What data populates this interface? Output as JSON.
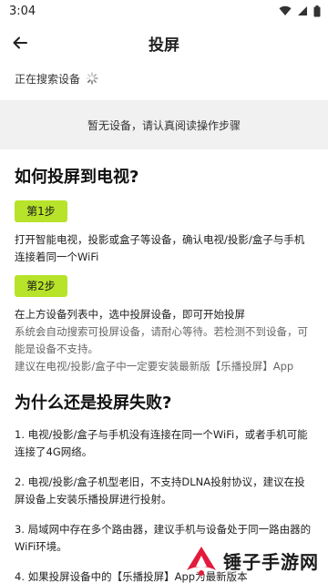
{
  "status_bar": {
    "time": "3:04"
  },
  "app_bar": {
    "title": "投屏"
  },
  "search": {
    "status_text": "正在搜索设备"
  },
  "device_list": {
    "empty_text": "暂无设备，请认真阅读操作步骤"
  },
  "how_to": {
    "title": "如何投屏到电视?",
    "step1": {
      "label": "第1步",
      "text": "打开智能电视，投影或盒子等设备，确认电视/投影/盒子与手机连接着同一个WiFi"
    },
    "step2": {
      "label": "第2步",
      "text": "在上方设备列表中，选中投屏设备，即可开始投屏",
      "note1": "系统会自动搜索可投屏设备，请耐心等待。若检测不到设备，可能是设备不支持。",
      "note2": "建议在电视/投影/盒子中一定要安装最新版【乐播投屏】App"
    }
  },
  "why_fail": {
    "title": "为什么还是投屏失败?",
    "items": [
      "1. 电视/投影/盒子与手机没有连接在同一个WiFi，或者手机可能连接了4G网络。",
      "2. 电视/投影/盒子机型老旧，不支持DLNA投射协议，建议在投屏设备上安装乐播投屏进行投射。",
      "3. 局域网中存在多个路由器，建议手机与设备处于同一路由器的WiFi环境。",
      "4. 如果投屏设备中的【乐播投屏】App为最新版本"
    ]
  },
  "watermark": {
    "text": "锤子手游网"
  },
  "colors": {
    "accent": "#b7e32a",
    "panel": "#f1f1f1",
    "logo_red": "#e21b3c"
  }
}
